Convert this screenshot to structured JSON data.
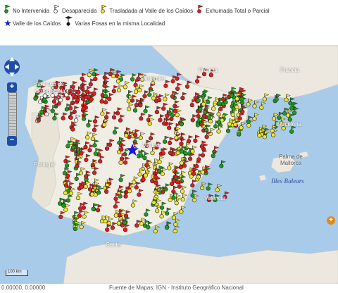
{
  "legend": {
    "items": [
      {
        "label": "No Intervenida",
        "color": "#1a9e1a",
        "icon": "green-flag-marker-icon"
      },
      {
        "label": "Desaparecida",
        "color": "#ffffff",
        "icon": "white-flag-marker-icon"
      },
      {
        "label": "Trasladada al Valle de los Caídos",
        "color": "#f2e62a",
        "icon": "yellow-flag-marker-icon"
      },
      {
        "label": "Exhumada Total o Parcial",
        "color": "#e31a1a",
        "icon": "red-flag-marker-icon"
      }
    ],
    "items2": [
      {
        "label": "Valle de los Caídos",
        "color": "#1a1ad6",
        "icon": "blue-star-icon"
      },
      {
        "label": "Varias Fosas en la misma Localidad",
        "color": "#111111",
        "icon": "multi-flag-marker-icon"
      }
    ]
  },
  "map": {
    "places": {
      "francia1": "Francia",
      "francia2": "Francia",
      "portugal": "Portugal",
      "santander": "Santander",
      "santiago": "Santiago de",
      "compostela": "Compostela",
      "madrid": "Madrid",
      "barcelona": "Barcelona",
      "palma": "Palma de",
      "mallorca": "Mallorca",
      "illes": "Illes Balears",
      "ceuta": "Ceuta",
      "valencia": "Valencia"
    },
    "scale_label": "100 km",
    "expand_icon": "+"
  },
  "footer": {
    "coordinates": "0.00000, 0.00000",
    "source": "Fuente de Mapas: IGN - Instituto Geográfico Nacional"
  }
}
